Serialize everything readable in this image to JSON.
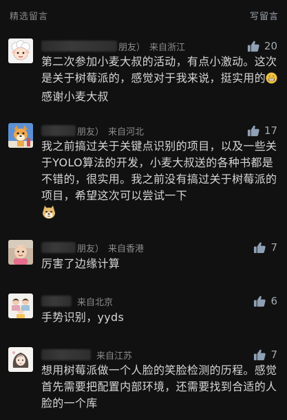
{
  "header": {
    "title": "精选留言",
    "write_label": "写留言"
  },
  "comments": [
    {
      "name_suffix": "朋友）",
      "location": "来自浙江",
      "likes": "20",
      "text_1": "第二次参加小麦大叔的活动，有点小激动。这次是关于树莓派的，感觉对于我来说，挺实用的",
      "emoji": "grin-emoji",
      "text_2": "感谢小麦大叔"
    },
    {
      "name_suffix": "朋友）",
      "location": "来自河北",
      "likes": "17",
      "text_1": "我之前搞过关于关键点识别的项目，以及一些关于YOLO算法的开发，小麦大叔送的各种书都是不错的，很实用。我之前没有搞过关于树莓派的项目，希望这次可以尝试一下",
      "emoji": "doge-emoji"
    },
    {
      "name_suffix": "朋友）",
      "location": "来自香港",
      "likes": "7",
      "text_1": "厉害了边缘计算"
    },
    {
      "name_suffix": "",
      "location": "来自北京",
      "likes": "6",
      "text_1": "手势识别，yyds"
    },
    {
      "name_suffix": "",
      "location": "来自江苏",
      "likes": "7",
      "text_1": "想用树莓派做一个人脸的笑脸检测的历程。感觉首先需要把配置内部环境，还需要找到合适的人脸的一个库"
    }
  ],
  "icons": {
    "like": "thumbs-up-icon"
  },
  "colors": {
    "background": "#111111",
    "like_icon": "#8fa0b4"
  }
}
